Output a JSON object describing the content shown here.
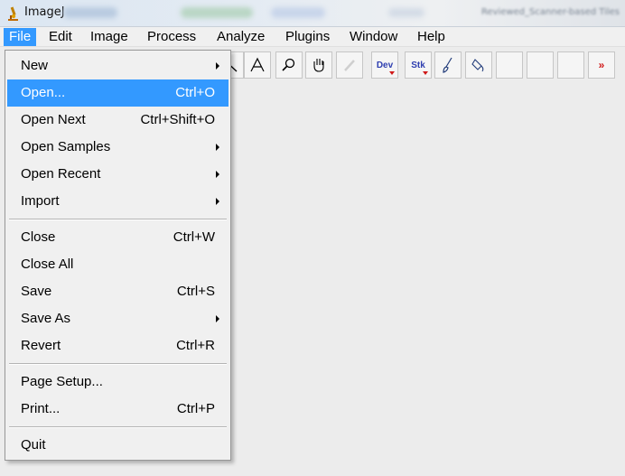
{
  "window": {
    "title": "ImageJ",
    "right_title_blurred": "Reviewed_Scanner-based Tiles"
  },
  "menubar": {
    "items": [
      "File",
      "Edit",
      "Image",
      "Process",
      "Analyze",
      "Plugins",
      "Window",
      "Help"
    ],
    "active": "File"
  },
  "toolbar": {
    "dev_label": "Dev",
    "stk_label": "Stk",
    "more_label": "»"
  },
  "file_menu": {
    "items": [
      {
        "label": "New",
        "shortcut": "",
        "submenu": true
      },
      {
        "label": "Open...",
        "shortcut": "Ctrl+O",
        "submenu": false,
        "highlighted": true
      },
      {
        "label": "Open Next",
        "shortcut": "Ctrl+Shift+O",
        "submenu": false
      },
      {
        "label": "Open Samples",
        "shortcut": "",
        "submenu": true
      },
      {
        "label": "Open Recent",
        "shortcut": "",
        "submenu": true
      },
      {
        "label": "Import",
        "shortcut": "",
        "submenu": true
      },
      {
        "label": "Close",
        "shortcut": "Ctrl+W",
        "submenu": false
      },
      {
        "label": "Close All",
        "shortcut": "",
        "submenu": false
      },
      {
        "label": "Save",
        "shortcut": "Ctrl+S",
        "submenu": false
      },
      {
        "label": "Save As",
        "shortcut": "",
        "submenu": true
      },
      {
        "label": "Revert",
        "shortcut": "Ctrl+R",
        "submenu": false
      },
      {
        "label": "Page Setup...",
        "shortcut": "",
        "submenu": false
      },
      {
        "label": "Print...",
        "shortcut": "Ctrl+P",
        "submenu": false
      },
      {
        "label": "Quit",
        "shortcut": "",
        "submenu": false
      }
    ]
  },
  "colors": {
    "highlight": "#3399ff",
    "menu_bg": "#f0f0f0",
    "workspace_bg": "#ececec",
    "tool_accent": "#d01818",
    "tool_text_blue": "#2f3fb0"
  },
  "icons": {
    "app": "microscope-icon",
    "tools": [
      "line-tool-icon",
      "text-tool-icon",
      "magnifier-icon",
      "hand-scroll-icon",
      "color-picker-icon",
      "dev-menu-icon",
      "stk-menu-icon",
      "brush-icon",
      "flood-fill-icon",
      "more-tools-icon"
    ]
  }
}
